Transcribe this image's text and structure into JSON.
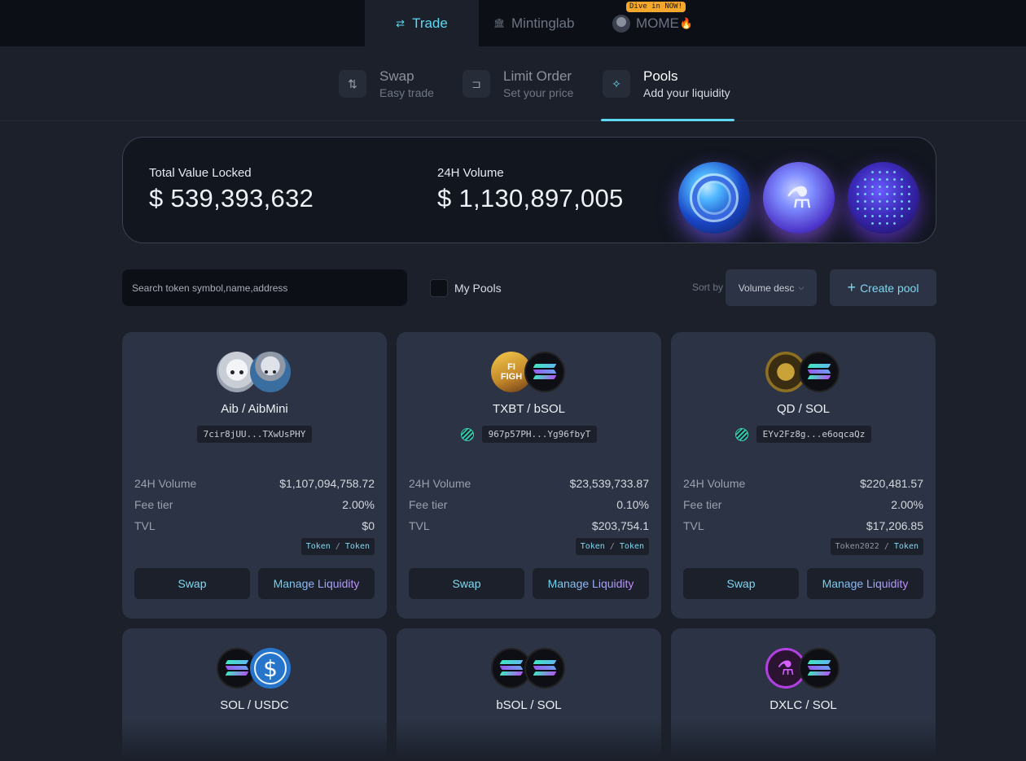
{
  "topnav": {
    "tabs": [
      {
        "label": "Trade",
        "icon": "swap-arrows-icon",
        "active": true
      },
      {
        "label": "Mintinglab",
        "icon": "bank-icon",
        "active": false
      },
      {
        "label": "MOME",
        "icon": "avatar-icon",
        "active": false
      }
    ],
    "badge": "Dive in NOW!"
  },
  "subnav": {
    "items": [
      {
        "title": "Swap",
        "subtitle": "Easy trade",
        "icon": "swap-icon",
        "active": false
      },
      {
        "title": "Limit Order",
        "subtitle": "Set your price",
        "icon": "limit-icon",
        "active": false
      },
      {
        "title": "Pools",
        "subtitle": "Add your liquidity",
        "icon": "sparkles-icon",
        "active": true
      }
    ]
  },
  "stats": {
    "tvl_label": "Total Value Locked",
    "tvl_value": "$ 539,393,632",
    "volume_label": "24H Volume",
    "volume_value": "$ 1,130,897,005"
  },
  "toolbar": {
    "search_placeholder": "Search token symbol,name,address",
    "my_pools_label": "My Pools",
    "sort_label": "Sort by",
    "sort_value": "Volume desc",
    "create_label": "Create pool"
  },
  "labels": {
    "volume": "24H Volume",
    "fee": "Fee tier",
    "tvl": "TVL",
    "swap": "Swap",
    "manage": "Manage Liquidity"
  },
  "pools": [
    {
      "pair": "Aib / AibMini",
      "address": "7cir8jUU...TXwUsPHY",
      "volume": "$1,107,094,758.72",
      "fee": "2.00%",
      "tvl": "$0",
      "tag_a": "Token",
      "tag_b": "Token"
    },
    {
      "pair": "TXBT / bSOL",
      "address": "967p57PH...Yg96fbyT",
      "volume": "$23,539,733.87",
      "fee": "0.10%",
      "tvl": "$203,754.1",
      "tag_a": "Token",
      "tag_b": "Token"
    },
    {
      "pair": "QD / SOL",
      "address": "EYv2Fz8g...e6oqcaQz",
      "volume": "$220,481.57",
      "fee": "2.00%",
      "tvl": "$17,206.85",
      "tag_a": "Token2022",
      "tag_b": "Token"
    },
    {
      "pair": "SOL / USDC"
    },
    {
      "pair": "bSOL / SOL"
    },
    {
      "pair": "DXLC / SOL"
    }
  ]
}
